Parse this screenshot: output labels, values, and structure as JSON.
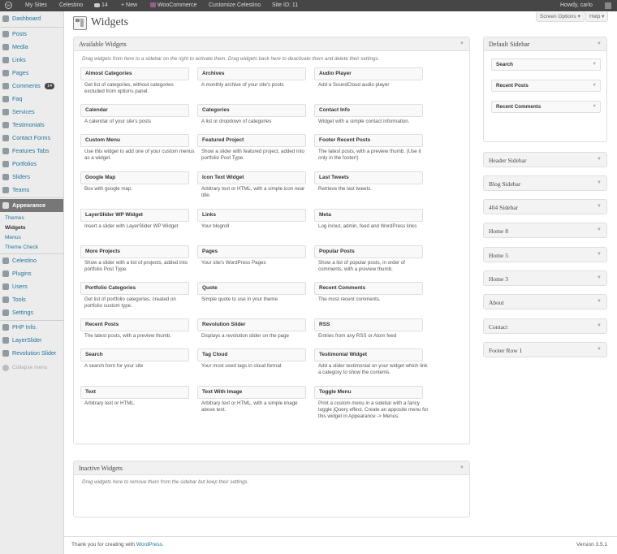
{
  "adminbar": {
    "my_sites": "My Sites",
    "site": "Celestino",
    "comments_count": "14",
    "new": "+ New",
    "woocommerce": "WooCommerce",
    "customize": "Customize Celestino",
    "site_id": "Site ID: 11",
    "howdy": "Howdy, carlo"
  },
  "menu": {
    "dashboard": "Dashboard",
    "posts": "Posts",
    "media": "Media",
    "links": "Links",
    "pages": "Pages",
    "comments": "Comments",
    "comments_badge": "14",
    "faq": "Faq",
    "services": "Services",
    "testimonials": "Testimonials",
    "contact_forms": "Contact Forms",
    "features_tabs": "Features Tabs",
    "portfolios": "Portfolios",
    "sliders": "Sliders",
    "teams": "Teams",
    "appearance": "Appearance",
    "themes": "Themes",
    "widgets": "Widgets",
    "menus": "Menus",
    "theme_check": "Theme Check",
    "celestino": "Celestino",
    "plugins": "Plugins",
    "users": "Users",
    "tools": "Tools",
    "settings": "Settings",
    "php_info": "PHP Info.",
    "layerslider": "LayerSlider",
    "revolution_slider": "Revolution Slider",
    "collapse": "Collapse menu"
  },
  "page": {
    "title": "Widgets",
    "screen_options": "Screen Options ▾",
    "help": "Help ▾"
  },
  "available": {
    "title": "Available Widgets",
    "description": "Drag widgets from here to a sidebar on the right to activate them. Drag widgets back here to deactivate them and delete their settings.",
    "widgets": [
      {
        "title": "Almost Categories",
        "desc": "Get list of categories, without categories excluded from options panel."
      },
      {
        "title": "Archives",
        "desc": "A monthly archive of your site's posts"
      },
      {
        "title": "Audio Player",
        "desc": "Add a SoundCloud audio player"
      },
      {
        "title": "Calendar",
        "desc": "A calendar of your site's posts"
      },
      {
        "title": "Categories",
        "desc": "A list or dropdown of categories"
      },
      {
        "title": "Contact Info",
        "desc": "Widget with a simple contact information."
      },
      {
        "title": "Custom Menu",
        "desc": "Use this widget to add one of your custom menus as a widget."
      },
      {
        "title": "Featured Project",
        "desc": "Show a slider with featured project, added into portfolio Post Type."
      },
      {
        "title": "Footer Recent Posts",
        "desc": "The latest posts, with a preview thumb. (Use it only in the footer!)"
      },
      {
        "title": "Google Map",
        "desc": "Box with google map."
      },
      {
        "title": "Icon Text Widget",
        "desc": "Arbitrary text or HTML, with a simple icon near title."
      },
      {
        "title": "Last Tweets",
        "desc": "Retrieve the last tweets."
      },
      {
        "title": "LayerSlider WP Widget",
        "desc": "Insert a slider with LayerSlider WP Widget"
      },
      {
        "title": "Links",
        "desc": "Your blogroll"
      },
      {
        "title": "Meta",
        "desc": "Log in/out, admin, feed and WordPress links"
      },
      {
        "title": "More Projects",
        "desc": "Show a slider with a list of projects, added into portfolio Post Type."
      },
      {
        "title": "Pages",
        "desc": "Your site's WordPress Pages"
      },
      {
        "title": "Popular Posts",
        "desc": "Show a list of popular posts, in order of comments, with a preview thumb."
      },
      {
        "title": "Portfolio Categories",
        "desc": "Get list of portfolio categories, created on portfolio custom type."
      },
      {
        "title": "Quote",
        "desc": "Simple quote to use in your theme"
      },
      {
        "title": "Recent Comments",
        "desc": "The most recent comments."
      },
      {
        "title": "Recent Posts",
        "desc": "The latest posts, with a preview thumb."
      },
      {
        "title": "Revolution Slider",
        "desc": "Displays a revolution slider on the page"
      },
      {
        "title": "RSS",
        "desc": "Entries from any RSS or Atom feed"
      },
      {
        "title": "Search",
        "desc": "A search form for your site"
      },
      {
        "title": "Tag Cloud",
        "desc": "Your most used tags in cloud format"
      },
      {
        "title": "Testimonial Widget",
        "desc": "Add a slider testimonial on your widget which link a category to show the contents."
      },
      {
        "title": "Text",
        "desc": "Arbitrary text or HTML."
      },
      {
        "title": "Text With Image",
        "desc": "Arbitrary text or HTML, with a simple image above text."
      },
      {
        "title": "Toggle Menu",
        "desc": "Print a custom menu in a sidebar with a fancy toggle jQuery effect. Create an apposite menu for this widget in Appearance -> Menus."
      }
    ]
  },
  "inactive": {
    "title": "Inactive Widgets",
    "description": "Drag widgets here to remove them from the sidebar but keep their settings."
  },
  "sidebars": {
    "default": {
      "title": "Default Sidebar",
      "widgets": [
        "Search",
        "Recent Posts",
        "Recent Comments"
      ]
    },
    "others": [
      "Header Sidebar",
      "Blog Sidebar",
      "404 Sidebar",
      "Home 8",
      "Home 5",
      "Home 3",
      "About",
      "Contact",
      "Footer Row 1"
    ]
  },
  "footer": {
    "thanks_prefix": "Thank you for creating with ",
    "wordpress": "WordPress",
    "thanks_suffix": ".",
    "version": "Version 3.5.1"
  }
}
